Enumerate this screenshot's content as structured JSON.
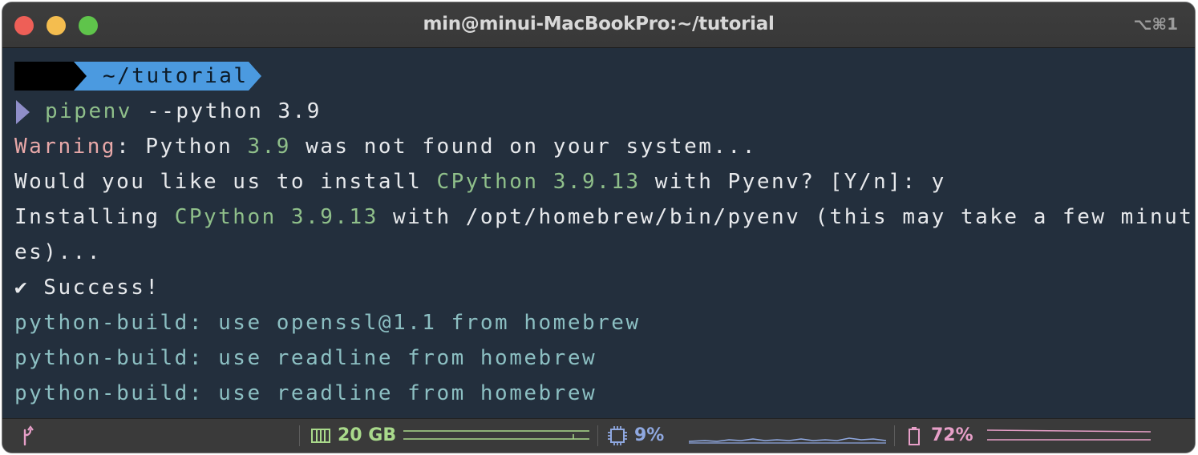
{
  "window": {
    "title": "min@minui-MacBookPro:~/tutorial",
    "shortcut": "⌥⌘1"
  },
  "prompt": {
    "icon": "⚡",
    "directory": "~/tutorial"
  },
  "command": {
    "program": "pipenv",
    "args": " --python 3.9"
  },
  "output": {
    "line1": {
      "warning": "Warning",
      "a": ": Python ",
      "version": "3.9",
      "b": " was not found on your system..."
    },
    "line2": {
      "a": "Would you like us to install ",
      "cpython": "CPython",
      "sp": " ",
      "version": "3.9.13",
      "b": " with Pyenv? [Y/n]: y"
    },
    "line3": {
      "a": "Installing ",
      "cpython": "CPython",
      "sp": " ",
      "version": "3.9.13",
      "b": " with /opt/homebrew/bin/pyenv (this may take a few minut"
    },
    "line4": "es)...",
    "line5": "✔ Success!",
    "line6": "python-build: use openssl@1.1 from homebrew",
    "line7": "python-build: use readline from homebrew",
    "line8": "python-build: use readline from homebrew"
  },
  "statusbar": {
    "branch_icon": "git-branch-icon",
    "memory": "20 GB",
    "cpu": "9%",
    "battery": "72%",
    "colors": {
      "memory": "#a9d98b",
      "cpu": "#8fa8e0",
      "battery": "#e79fc8"
    }
  }
}
